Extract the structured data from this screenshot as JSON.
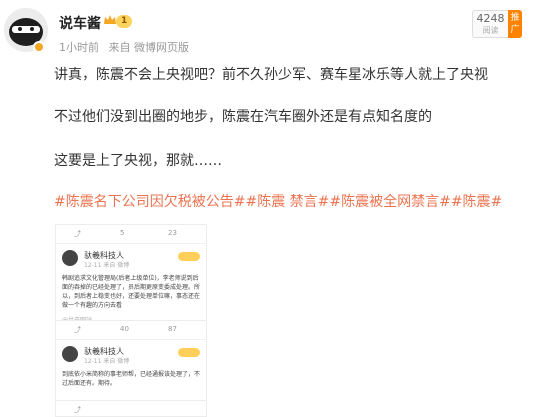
{
  "header": {
    "author": "说车酱",
    "level_badge": "1",
    "time": "1小时前",
    "source": "来自 微博网页版",
    "read_count": "4248",
    "read_label": "阅读",
    "promote_label": "推广"
  },
  "post": {
    "paragraphs": [
      "讲真，陈震不会上央视吧？前不久孙少军、赛车星冰乐等人就上了央视",
      "不过他们没到出圈的地步，陈震在汽车圈外还是有点知名度的",
      "这要是上了央视，那就……"
    ],
    "tags": "#陈震名下公司因欠税被公告##陈震 禁言##陈震被全网禁言##陈震#"
  },
  "screenshots": [
    {
      "actions": [
        "⤴",
        "5",
        "23"
      ],
      "username": "驮羲科技人",
      "sub": "12-11 来自 微博",
      "text": "韩剧追求文化管理局(后者上级单位)，李老师说到后面的吞掉的已经处理了，员后期更原变委成处理。所以，到后者上稳变也好，还要处理单位嘛，事态还在做一个有趣的方向去看",
      "source": "@共产网站"
    },
    {
      "actions": [
        "⤴",
        "40",
        "87"
      ],
      "username": "驮羲科技人",
      "sub": "12-11 来自 微博",
      "text": "到底依小米简称的事老师帮，已经通报该处理了，不过后面还有。期待。"
    },
    {
      "actions": [
        "⤴",
        "",
        ""
      ]
    }
  ]
}
